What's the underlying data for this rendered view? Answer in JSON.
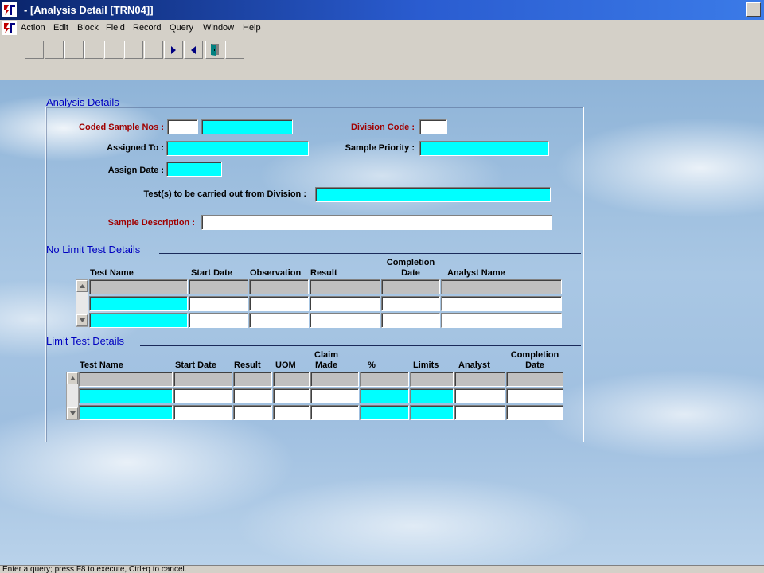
{
  "window": {
    "title": "- [Analysis Detail [TRN04]]"
  },
  "menu": {
    "items": [
      "Action",
      "Edit",
      "Block",
      "Field",
      "Record",
      "Query",
      "Window",
      "Help"
    ]
  },
  "toolbar": {
    "buttons": [
      "blank",
      "blank",
      "blank",
      "blank",
      "blank",
      "blank",
      "blank",
      "next-record-icon",
      "previous-record-icon",
      "exit-door-icon"
    ]
  },
  "analysis_details": {
    "title": "Analysis Details",
    "coded_sample_nos_label": "Coded Sample Nos :",
    "coded_sample_nos_value1": "",
    "coded_sample_nos_value2": "",
    "division_code_label": "Division Code :",
    "division_code_value": "",
    "assigned_to_label": "Assigned To :",
    "assigned_to_value": "",
    "sample_priority_label": "Sample Priority :",
    "sample_priority_value": "",
    "assign_date_label": "Assign Date :",
    "assign_date_value": "",
    "tests_label": "Test(s) to be carried out from Division :",
    "tests_value": "",
    "sample_description_label": "Sample Description :",
    "sample_description_value": ""
  },
  "no_limit": {
    "title": "No Limit Test Details",
    "headers": {
      "test_name": "Test Name",
      "start_date": "Start Date",
      "observation": "Observation",
      "result": "Result",
      "completion_1": "Completion",
      "completion_2": "Date",
      "analyst_name": "Analyst Name"
    }
  },
  "limit": {
    "title": "Limit Test Details",
    "headers": {
      "test_name": "Test Name",
      "start_date": "Start Date",
      "result": "Result",
      "uom": "UOM",
      "claim_1": "Claim",
      "claim_2": "Made",
      "percent": "%",
      "limits": "Limits",
      "analyst": "Analyst",
      "completion_1": "Completion",
      "completion_2": "Date"
    }
  },
  "status": {
    "message": "Enter a query;  press F8 to execute, Ctrl+q  to cancel."
  },
  "colors": {
    "required_label": "#a00000",
    "section_title": "#0000c0",
    "highlight_field": "#00ffff"
  }
}
